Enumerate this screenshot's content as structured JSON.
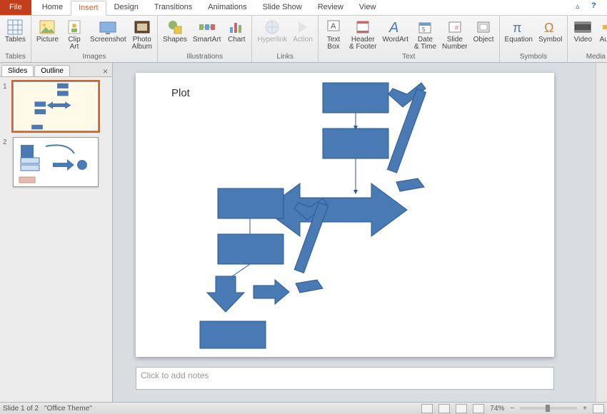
{
  "tabs": {
    "file": "File",
    "items": [
      "Home",
      "Insert",
      "Design",
      "Transitions",
      "Animations",
      "Slide Show",
      "Review",
      "View"
    ],
    "active": "Insert"
  },
  "ribbon": {
    "groups": [
      {
        "label": "Tables",
        "items": [
          {
            "name": "tables",
            "label": "Tables"
          }
        ]
      },
      {
        "label": "Images",
        "items": [
          {
            "name": "picture",
            "label": "Picture"
          },
          {
            "name": "clip-art",
            "label": "Clip\nArt"
          },
          {
            "name": "screenshot",
            "label": "Screenshot"
          },
          {
            "name": "photo-album",
            "label": "Photo\nAlbum"
          }
        ]
      },
      {
        "label": "Illustrations",
        "items": [
          {
            "name": "shapes",
            "label": "Shapes"
          },
          {
            "name": "smartart",
            "label": "SmartArt"
          },
          {
            "name": "chart",
            "label": "Chart"
          }
        ]
      },
      {
        "label": "Links",
        "items": [
          {
            "name": "hyperlink",
            "label": "Hyperlink",
            "disabled": true
          },
          {
            "name": "action",
            "label": "Action",
            "disabled": true
          }
        ]
      },
      {
        "label": "Text",
        "items": [
          {
            "name": "text-box",
            "label": "Text\nBox"
          },
          {
            "name": "header-footer",
            "label": "Header\n& Footer"
          },
          {
            "name": "wordart",
            "label": "WordArt"
          },
          {
            "name": "date-time",
            "label": "Date\n& Time"
          },
          {
            "name": "slide-number",
            "label": "Slide\nNumber"
          },
          {
            "name": "object",
            "label": "Object"
          }
        ]
      },
      {
        "label": "Symbols",
        "items": [
          {
            "name": "equation",
            "label": "Equation"
          },
          {
            "name": "symbol",
            "label": "Symbol"
          }
        ]
      },
      {
        "label": "Media",
        "items": [
          {
            "name": "video",
            "label": "Video"
          },
          {
            "name": "audio",
            "label": "Audio"
          }
        ]
      }
    ]
  },
  "side": {
    "tabs": {
      "slides": "Slides",
      "outline": "Outline"
    },
    "count": 2
  },
  "slide": {
    "title": "Plot"
  },
  "notes": {
    "placeholder": "Click to add notes"
  },
  "status": {
    "slide_of": "Slide 1 of 2",
    "theme": "\"Office Theme\"",
    "zoom": "74%"
  },
  "colors": {
    "shape_fill": "#4a7ab4",
    "shape_stroke": "#2b5a93"
  }
}
